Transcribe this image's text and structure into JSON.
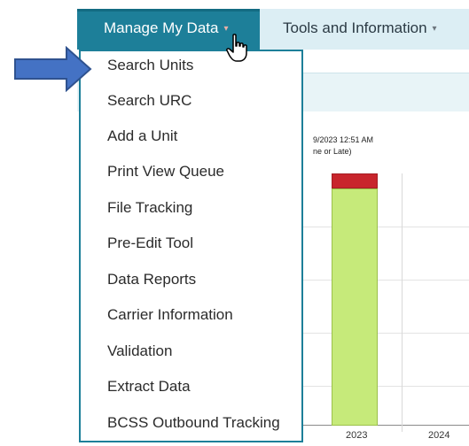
{
  "nav": {
    "manage_label": "Manage My Data",
    "tools_label": "Tools and Information",
    "caret": "▾",
    "active_color": "#1d7f99"
  },
  "menu": {
    "items": [
      "Search Units",
      "Search URC",
      "Add a Unit",
      "Print View Queue",
      "File Tracking",
      "Pre-Edit Tool",
      "Data Reports",
      "Carrier Information",
      "Validation",
      "Extract Data",
      "BCSS Outbound Tracking"
    ]
  },
  "chart_fragment": {
    "timestamp_text": "9/2023 12:51 AM",
    "subtitle_text": "ne or Late)",
    "bar_colors": {
      "on_time": "#c6ea7a",
      "late": "#c8252c"
    }
  },
  "chart_data": {
    "type": "bar",
    "categories": [
      "2023",
      "2024"
    ],
    "series": [
      {
        "values": [
          95,
          0
        ]
      },
      {
        "values": [
          5,
          0
        ]
      }
    ]
  },
  "icons": {
    "arrow": "arrow-right-icon",
    "cursor": "hand-pointer-icon"
  }
}
